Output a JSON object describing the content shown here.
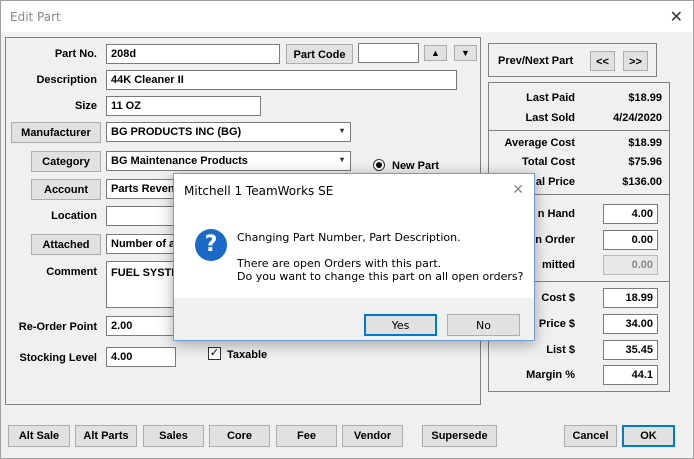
{
  "window": {
    "title": "Edit Part",
    "close_glyph": "✕"
  },
  "left": {
    "part_no_label": "Part No.",
    "part_no": "208d",
    "part_code_button": "Part Code",
    "part_code_value": "",
    "description_label": "Description",
    "description": "44K Cleaner II",
    "size_label": "Size",
    "size": "11 OZ",
    "manufacturer_button": "Manufacturer",
    "manufacturer": "BG PRODUCTS INC (BG)",
    "category_button": "Category",
    "category": "BG Maintenance Products",
    "new_part_label": "New Part",
    "account_button": "Account",
    "account": "Parts Reven",
    "location_label": "Location",
    "location": "",
    "attached_button": "Attached",
    "attached": "Number of a",
    "comment_label": "Comment",
    "comment": "FUEL SYSTE",
    "reorder_label": "Re-Order Point",
    "reorder": "2.00",
    "stocking_label": "Stocking Level",
    "stocking": "4.00",
    "taxable_label": "Taxable",
    "taxable_checked": "✓"
  },
  "right": {
    "prevnext_label": "Prev/Next Part",
    "prev_button": "<<",
    "next_button": ">>",
    "last_paid_label": "Last Paid",
    "last_paid": "$18.99",
    "last_sold_label": "Last Sold",
    "last_sold": "4/24/2020",
    "avg_cost_label": "Average Cost",
    "avg_cost": "$18.99",
    "total_cost_label": "Total Cost",
    "total_cost": "$75.96",
    "total_price_label": "al Price",
    "total_price": "$136.00",
    "on_hand_label": "n Hand",
    "on_hand": "4.00",
    "on_order_label": "n Order",
    "on_order": "0.00",
    "committed_label": "mitted",
    "committed": "0.00",
    "cost_label": "Cost $",
    "cost": "18.99",
    "price_label": "Price $",
    "price": "34.00",
    "list_label": "List $",
    "list": "35.45",
    "margin_label": "Margin %",
    "margin": "44.1"
  },
  "bottom": {
    "alt_sale": "Alt Sale",
    "alt_parts": "Alt Parts",
    "sales": "Sales",
    "core": "Core",
    "fee": "Fee",
    "vendor": "Vendor",
    "supersede": "Supersede",
    "cancel": "Cancel",
    "ok": "OK"
  },
  "dialog": {
    "title": "Mitchell 1 TeamWorks SE",
    "close_glyph": "✕",
    "icon_glyph": "?",
    "line1": "Changing Part Number, Part Description.",
    "line2": "There are open Orders with this part.",
    "line3": "Do you want to change this part on all open orders?",
    "yes": "Yes",
    "no": "No"
  },
  "icons": {
    "up_arrow": "▲",
    "down_arrow": "▼",
    "combo_arrow": "▾"
  }
}
